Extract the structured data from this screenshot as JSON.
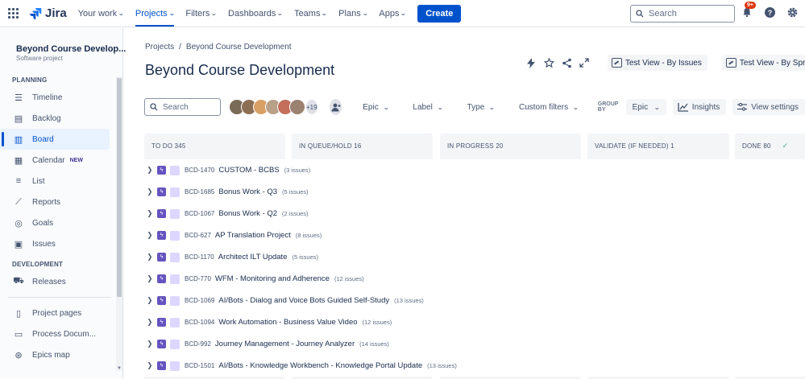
{
  "topnav": {
    "logo_text": "Jira",
    "items": [
      {
        "label": "Your work",
        "active": false
      },
      {
        "label": "Projects",
        "active": true
      },
      {
        "label": "Filters",
        "active": false
      },
      {
        "label": "Dashboards",
        "active": false
      },
      {
        "label": "Teams",
        "active": false
      },
      {
        "label": "Plans",
        "active": false
      },
      {
        "label": "Apps",
        "active": false
      }
    ],
    "create_label": "Create",
    "search_placeholder": "Search",
    "notifications_badge": "9+",
    "icons": [
      "notifications-icon",
      "help-icon",
      "settings-icon",
      "profile-icon"
    ]
  },
  "sidebar": {
    "project_name": "Beyond Course Develop...",
    "project_type": "Software project",
    "planning_title": "PLANNING",
    "planning_items": [
      {
        "label": "Timeline",
        "icon": "timeline-icon"
      },
      {
        "label": "Backlog",
        "icon": "backlog-icon"
      },
      {
        "label": "Board",
        "icon": "board-icon",
        "active": true
      },
      {
        "label": "Calendar",
        "icon": "calendar-icon",
        "badge": "NEW"
      },
      {
        "label": "List",
        "icon": "list-icon"
      },
      {
        "label": "Reports",
        "icon": "reports-icon"
      },
      {
        "label": "Goals",
        "icon": "goals-icon"
      },
      {
        "label": "Issues",
        "icon": "issues-icon"
      }
    ],
    "development_title": "DEVELOPMENT",
    "development_items": [
      {
        "label": "Releases",
        "icon": "releases-icon"
      }
    ],
    "bottom_items": [
      {
        "label": "Project pages",
        "icon": "pages-icon"
      },
      {
        "label": "Process Docum...",
        "icon": "document-icon"
      },
      {
        "label": "Epics map",
        "icon": "map-icon"
      }
    ]
  },
  "main": {
    "breadcrumb": [
      "Projects",
      "Beyond Course Development"
    ],
    "breadcrumb_sep": "/",
    "title": "Beyond Course Development",
    "views": [
      "Test View - By Issues",
      "Test View - By Sprint"
    ],
    "toolbar": {
      "search_placeholder": "Search",
      "avatar_colors": [
        "#7a6a58",
        "#8b6f55",
        "#d9a066",
        "#b8a089",
        "#c46f5c",
        "#9b8170"
      ],
      "more_people": "+19",
      "filters": [
        "Epic",
        "Label",
        "Type",
        "Custom filters"
      ],
      "group_by_label": "GROUP BY",
      "group_by_value": "Epic",
      "insights_label": "Insights",
      "view_settings_label": "View settings"
    },
    "columns": [
      {
        "label": "TO DO 345"
      },
      {
        "label": "IN QUEUE/HOLD 16"
      },
      {
        "label": "IN PROGRESS 20"
      },
      {
        "label": "VALIDATE (IF NEEDED) 1"
      },
      {
        "label": "DONE 80",
        "check": true
      }
    ],
    "epics": [
      {
        "key": "BCD-1470",
        "summary": "CUSTOM - BCBS",
        "count": "(3 issues)"
      },
      {
        "key": "BCD-1685",
        "summary": "Bonus Work - Q3",
        "count": "(5 issues)"
      },
      {
        "key": "BCD-1067",
        "summary": "Bonus Work - Q2",
        "count": "(2 issues)"
      },
      {
        "key": "BCD-627",
        "summary": "AP Translation Project",
        "count": "(8 issues)"
      },
      {
        "key": "BCD-1170",
        "summary": "Architect ILT Update",
        "count": "(5 issues)"
      },
      {
        "key": "BCD-770",
        "summary": "WFM - Monitoring and Adherence",
        "count": "(12 issues)"
      },
      {
        "key": "BCD-1069",
        "summary": "AI/Bots - Dialog and Voice Bots Guided Self-Study",
        "count": "(13 issues)"
      },
      {
        "key": "BCD-1094",
        "summary": "Work Automation - Business Value Video",
        "count": "(12 issues)"
      },
      {
        "key": "BCD-992",
        "summary": "Journey Management - Journey Analyzer",
        "count": "(14 issues)"
      },
      {
        "key": "BCD-1501",
        "summary": "AI/Bots - Knowledge Workbench - Knowledge Portal Update",
        "count": "(13 issues)"
      }
    ]
  }
}
